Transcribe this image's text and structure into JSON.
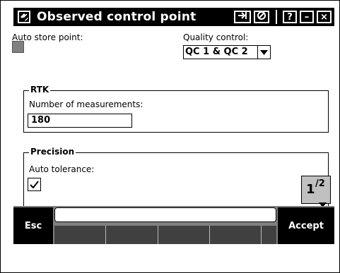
{
  "window": {
    "title": "Observed control point",
    "app_icon": "satellite-icon",
    "buttons": {
      "switch": "switch-app-icon",
      "close_form": "no-entry-icon",
      "help": "?",
      "minimize": "–",
      "close": "×"
    }
  },
  "form": {
    "auto_store_label": "Auto store point:",
    "auto_store_checked": false,
    "quality_label": "Quality control:",
    "quality_value": "QC 1 & QC 2",
    "rtk": {
      "group_title": "RTK",
      "measurements_label": "Number of measurements:",
      "measurements_value": "180"
    },
    "precision": {
      "group_title": "Precision",
      "auto_tolerance_label": "Auto tolerance:",
      "auto_tolerance_checked": true
    }
  },
  "pager": {
    "current": "1",
    "total": "2"
  },
  "softkeys": {
    "esc": "Esc",
    "accept": "Accept"
  }
}
